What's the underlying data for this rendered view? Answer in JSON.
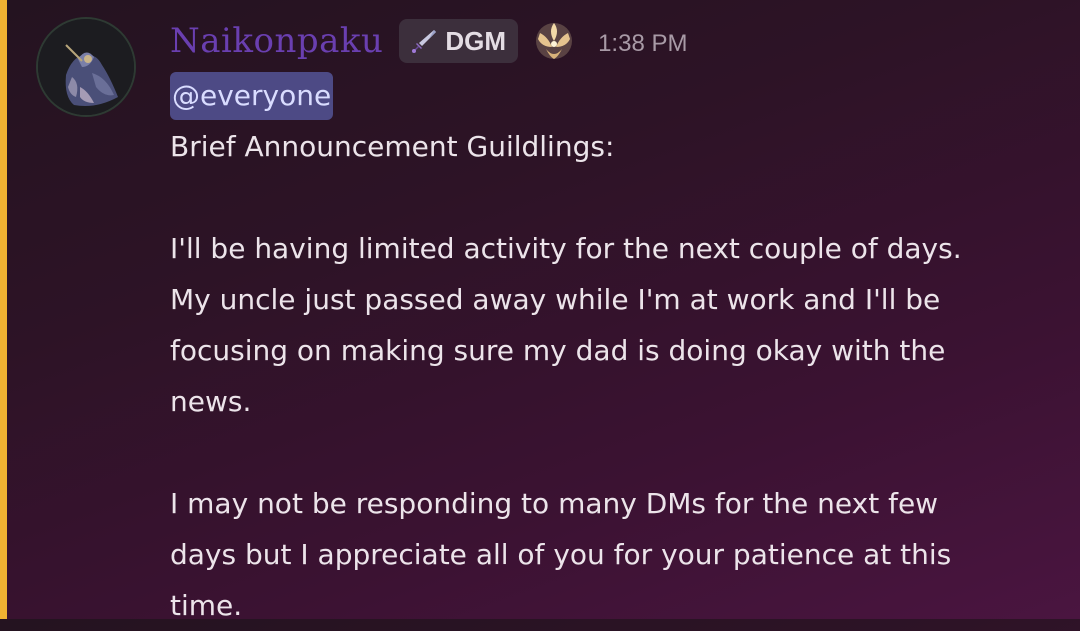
{
  "message": {
    "author": {
      "name": "Naikonpaku",
      "role_tag": "DGM",
      "role_icon": "sword-icon",
      "badge_icon": "crest-icon",
      "name_color": "#6a3fb0"
    },
    "timestamp": "1:38 PM",
    "mention": "@everyone",
    "lines": [
      "Brief Announcement Guildlings:",
      "",
      "I'll be having limited activity for the next couple of days.",
      "My uncle just passed away while I'm at work and I'll be",
      "focusing on making sure my dad is doing okay with the",
      "news.",
      "",
      "I may not be responding to many DMs for the next few",
      "days but I appreciate all of you for your patience at this",
      "time."
    ],
    "mention_highlight_color": "#f0b232"
  }
}
